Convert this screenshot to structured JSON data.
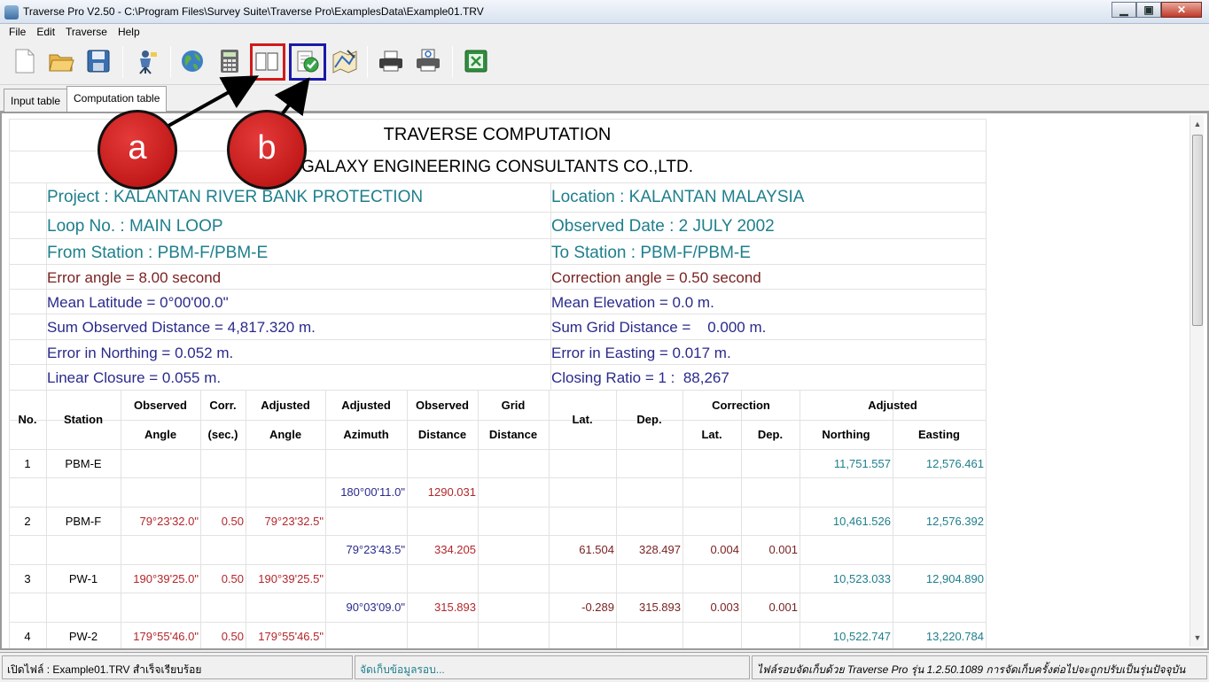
{
  "window": {
    "title": "Traverse Pro V2.50 - C:\\Program Files\\Survey Suite\\Traverse Pro\\ExamplesData\\Example01.TRV"
  },
  "menu": [
    "File",
    "Edit",
    "Traverse",
    "Help"
  ],
  "toolbar_icons": [
    "new-file-icon",
    "open-folder-icon",
    "save-icon",
    "surveyor-icon",
    "globe-icon",
    "calculator-icon",
    "book-icon",
    "check-compute-icon",
    "map-plot-icon",
    "printer-icon",
    "print-preview-icon",
    "excel-icon"
  ],
  "tabs": [
    "Input table",
    "Computation table"
  ],
  "annotations": {
    "a": "a",
    "b": "b",
    "box_a_color": "#d11a1a",
    "box_b_color": "#1a1aa8"
  },
  "report": {
    "title": "TRAVERSE COMPUTATION",
    "company": "GALAXY ENGINEERING CONSULTANTS CO.,LTD.",
    "project": "Project : KALANTAN RIVER BANK PROTECTION",
    "location": "Location : KALANTAN MALAYSIA",
    "loop": "Loop No. : MAIN LOOP",
    "observed_date": "Observed Date : 2 JULY 2002",
    "from_station": "From Station : PBM-F/PBM-E",
    "to_station": "To Station : PBM-F/PBM-E",
    "error_angle": "Error angle = 8.00 second",
    "correction_angle": "Correction angle = 0.50 second",
    "mean_latitude": "Mean Latitude = 0°00'00.0\"",
    "mean_elevation": "Mean Elevation =  0.0 m.",
    "sum_observed": "Sum Observed Distance = 4,817.320 m.",
    "sum_grid": "Sum Grid Distance =    0.000 m.",
    "error_northing": "Error in Northing = 0.052 m.",
    "error_easting": "Error in Easting = 0.017 m.",
    "linear_closure": "Linear Closure = 0.055 m.",
    "closing_ratio": "Closing Ratio = 1 :  88,267"
  },
  "table": {
    "headers": {
      "no": "No.",
      "station": "Station",
      "observed": "Observed",
      "angle": "Angle",
      "corr": "Corr.",
      "sec": "(sec.)",
      "adjusted": "Adjusted",
      "adj_angle": "Angle",
      "adjusted2": "Adjusted",
      "azimuth": "Azimuth",
      "observed2": "Observed",
      "distance": "Distance",
      "grid": "Grid",
      "grid_distance": "Distance",
      "lat": "Lat.",
      "dep": "Dep.",
      "correction": "Correction",
      "corr_lat": "Lat.",
      "corr_dep": "Dep.",
      "adjusted3": "Adjusted",
      "northing": "Northing",
      "easting": "Easting"
    },
    "station_rows": [
      {
        "no": "1",
        "station": "PBM-E",
        "obs_angle": "",
        "corr": "",
        "adj_angle": "",
        "northing": "11,751.557",
        "easting": "12,576.461"
      },
      {
        "no": "2",
        "station": "PBM-F",
        "obs_angle": "79°23'32.0\"",
        "corr": "0.50",
        "adj_angle": "79°23'32.5\"",
        "northing": "10,461.526",
        "easting": "12,576.392"
      },
      {
        "no": "3",
        "station": "PW-1",
        "obs_angle": "190°39'25.0\"",
        "corr": "0.50",
        "adj_angle": "190°39'25.5\"",
        "northing": "10,523.033",
        "easting": "12,904.890"
      },
      {
        "no": "4",
        "station": "PW-2",
        "obs_angle": "179°55'46.0\"",
        "corr": "0.50",
        "adj_angle": "179°55'46.5\"",
        "northing": "10,522.747",
        "easting": "13,220.784"
      }
    ],
    "leg_rows": [
      {
        "azimuth": "180°00'11.0\"",
        "obs_distance": "1290.031",
        "lat": "",
        "dep": "",
        "c_lat": "",
        "c_dep": ""
      },
      {
        "azimuth": "79°23'43.5\"",
        "obs_distance": "334.205",
        "lat": "61.504",
        "dep": "328.497",
        "c_lat": "0.004",
        "c_dep": "0.001"
      },
      {
        "azimuth": "90°03'09.0\"",
        "obs_distance": "315.893",
        "lat": "-0.289",
        "dep": "315.893",
        "c_lat": "0.003",
        "c_dep": "0.001"
      }
    ]
  },
  "status": {
    "left": "เปิดไฟล์ : Example01.TRV  สำเร็จเรียบร้อย",
    "middle": "จัดเก็บข้อมูลรอบ...",
    "right": "ไฟล์รอบจัดเก็บด้วย Traverse Pro รุ่น 1.2.50.1089 การจัดเก็บครั้งต่อไปจะถูกปรับเป็นรุ่นปัจจุบัน"
  }
}
